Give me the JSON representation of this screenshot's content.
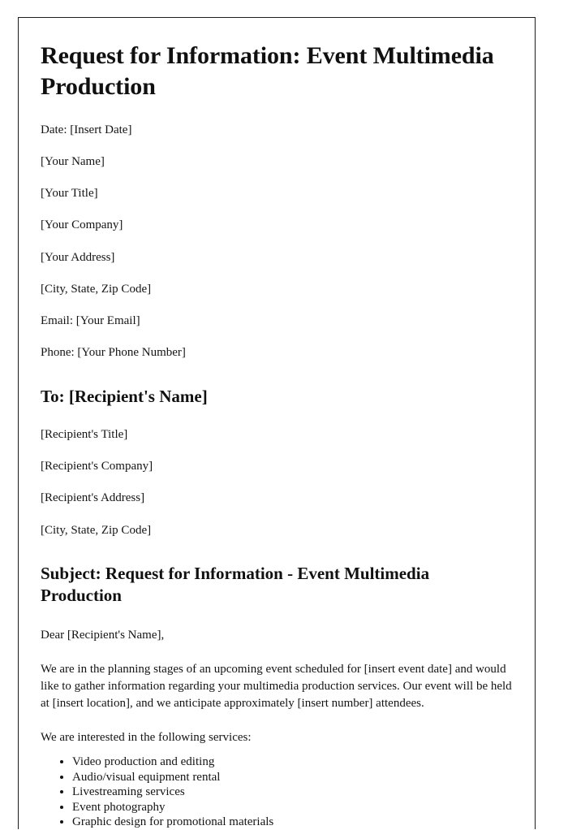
{
  "document": {
    "title": "Request for Information: Event Multimedia Production",
    "sender": {
      "lines": [
        "Date: [Insert Date]",
        "[Your Name]",
        "[Your Title]",
        "[Your Company]",
        "[Your Address]",
        "[City, State, Zip Code]",
        "Email: [Your Email]",
        "Phone: [Your Phone Number]"
      ]
    },
    "recipient": {
      "heading": "To: [Recipient's Name]",
      "lines": [
        "[Recipient's Title]",
        "[Recipient's Company]",
        "[Recipient's Address]",
        "[City, State, Zip Code]"
      ]
    },
    "subject_heading": "Subject: Request for Information - Event Multimedia Production",
    "salutation": "Dear [Recipient's Name],",
    "intro_paragraph": "We are in the planning stages of an upcoming event scheduled for [insert event date] and would like to gather information regarding your multimedia production services. Our event will be held at [insert location], and we anticipate approximately [insert number] attendees.",
    "services_lead_in": "We are interested in the following services:",
    "services": [
      "Video production and editing",
      "Audio/visual equipment rental",
      "Livestreaming services",
      "Event photography",
      "Graphic design for promotional materials"
    ]
  },
  "style": {
    "text_color": "#141414",
    "page_background": "#ffffff",
    "page_border_color": "#1d1d1d"
  }
}
